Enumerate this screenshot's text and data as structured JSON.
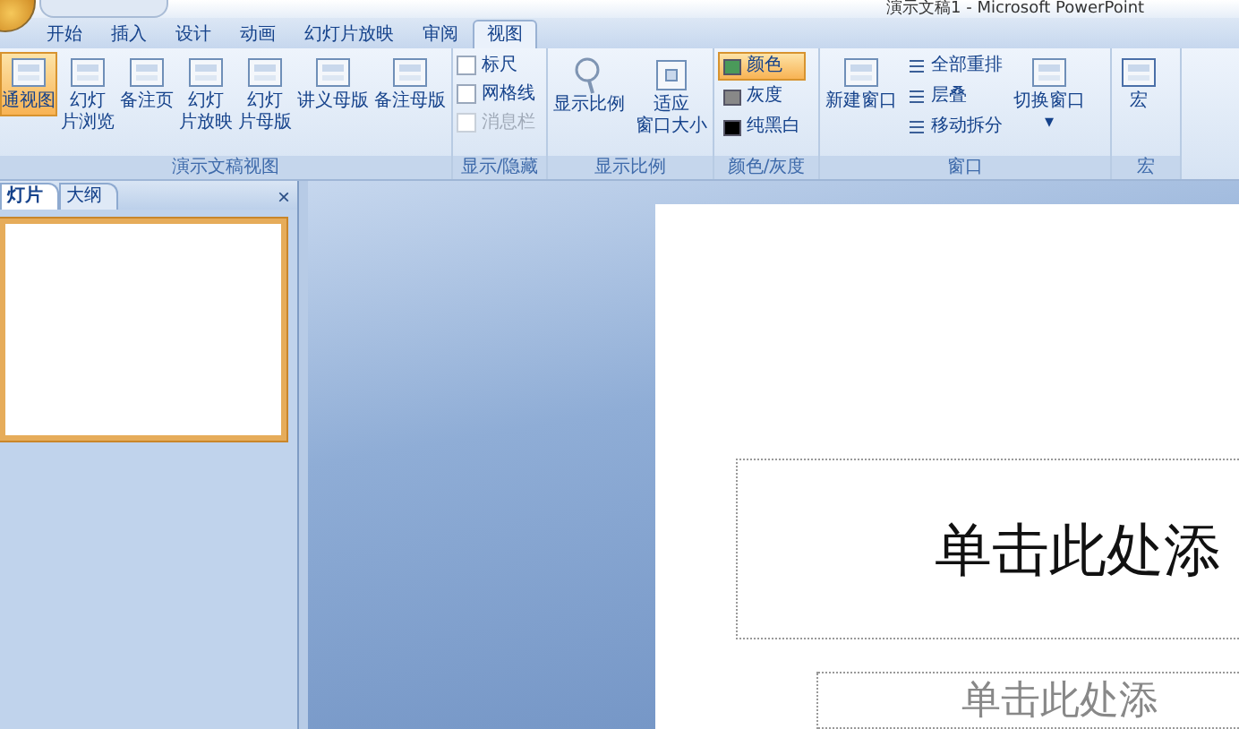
{
  "window": {
    "title": "演示文稿1 - Microsoft PowerPoint"
  },
  "tabs": [
    {
      "label": "开始",
      "selected": false
    },
    {
      "label": "插入",
      "selected": false
    },
    {
      "label": "设计",
      "selected": false
    },
    {
      "label": "动画",
      "selected": false
    },
    {
      "label": "幻灯片放映",
      "selected": false
    },
    {
      "label": "审阅",
      "selected": false
    },
    {
      "label": "视图",
      "selected": true
    }
  ],
  "ribbon": {
    "views": {
      "label": "演示文稿视图",
      "buttons": [
        {
          "lines": [
            "通视图"
          ],
          "selected": true
        },
        {
          "lines": [
            "幻灯",
            "片浏览"
          ],
          "selected": false
        },
        {
          "lines": [
            "备注页"
          ],
          "selected": false
        },
        {
          "lines": [
            "幻灯",
            "片放映"
          ],
          "selected": false
        },
        {
          "lines": [
            "幻灯",
            "片母版"
          ],
          "selected": false
        },
        {
          "lines": [
            "讲义母版"
          ],
          "selected": false
        },
        {
          "lines": [
            "备注母版"
          ],
          "selected": false
        }
      ]
    },
    "show_hide": {
      "label": "显示/隐藏",
      "options": [
        {
          "label": "标尺",
          "checked": false,
          "disabled": false
        },
        {
          "label": "网格线",
          "checked": false,
          "disabled": false
        },
        {
          "label": "消息栏",
          "checked": false,
          "disabled": true
        }
      ]
    },
    "zoom": {
      "label": "显示比例",
      "zoom_button": "显示比例",
      "fit_lines": [
        "适应",
        "窗口大小"
      ]
    },
    "color": {
      "label": "颜色/灰度",
      "options": [
        {
          "label": "颜色",
          "selected": true
        },
        {
          "label": "灰度",
          "selected": false
        },
        {
          "label": "纯黑白",
          "selected": false
        }
      ]
    },
    "window": {
      "label": "窗口",
      "new_window": "新建窗口",
      "items": [
        "全部重排",
        "层叠",
        "移动拆分"
      ],
      "switch": "切换窗口",
      "switch_caret": "▾"
    },
    "macros": {
      "label": "宏",
      "button": "宏"
    }
  },
  "pane": {
    "tabs": [
      {
        "label": "灯片",
        "selected": true
      },
      {
        "label": "大纲",
        "selected": false
      }
    ],
    "close": "×"
  },
  "slide": {
    "title_placeholder": "单击此处添",
    "subtitle_placeholder": "单击此处添"
  }
}
